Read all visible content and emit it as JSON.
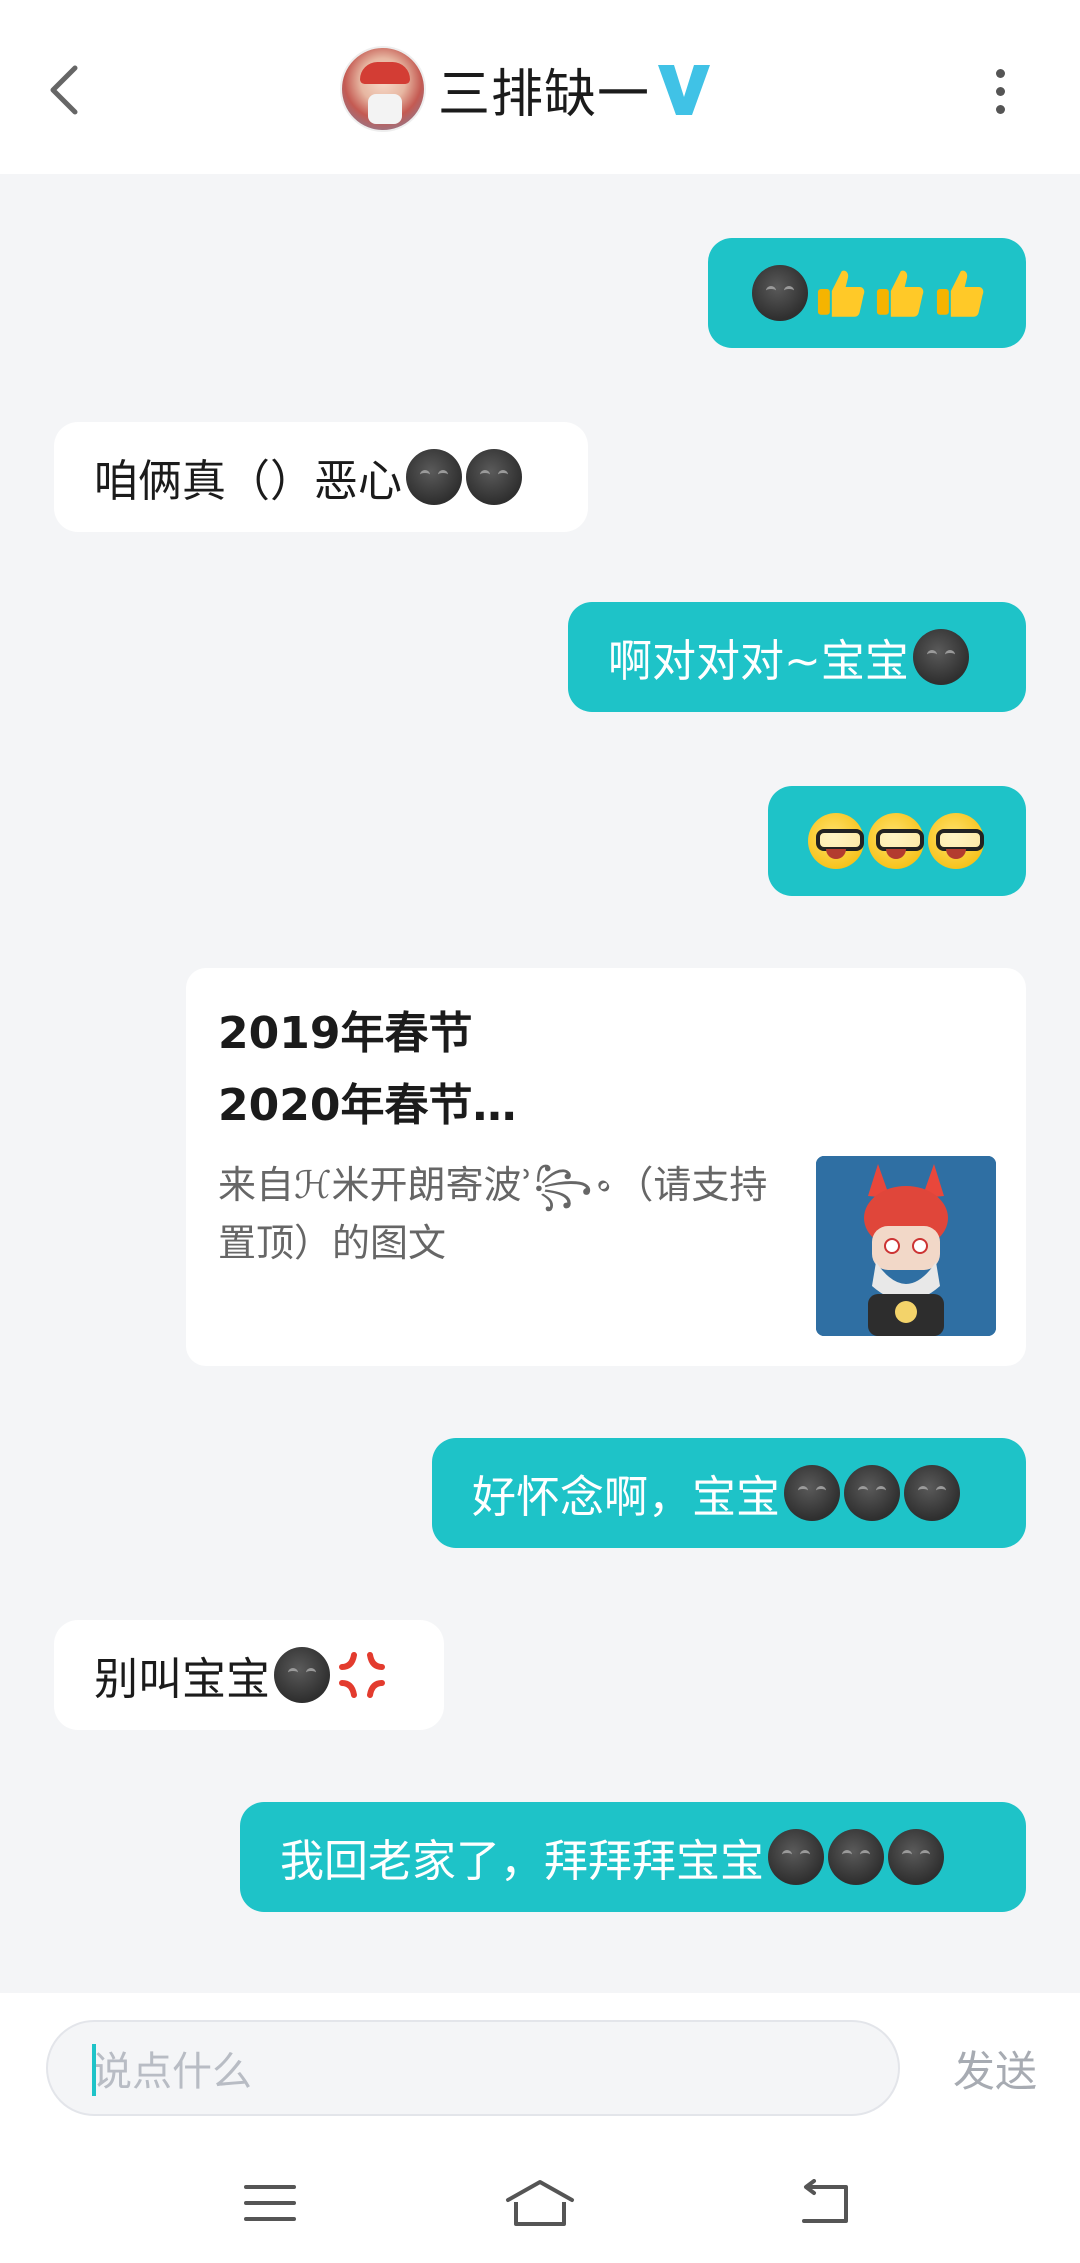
{
  "header": {
    "title": "三排缺一",
    "back_icon": "chevron-left-icon",
    "more_icon": "vertical-dots-icon",
    "badge_icon": "vip-v-icon",
    "badge_color": "#40c2e6"
  },
  "colors": {
    "sent_bubble": "#1ec3c8",
    "received_bubble": "#ffffff",
    "background": "#f4f5f7"
  },
  "messages": [
    {
      "side": "sent",
      "text": "",
      "emoji": [
        "smirk-face",
        "thumbs-up",
        "thumbs-up",
        "thumbs-up"
      ]
    },
    {
      "side": "received",
      "text": "咱俩真（）恶心",
      "emoji": [
        "smirk-face",
        "smirk-face"
      ]
    },
    {
      "side": "sent",
      "text": "啊对对对~宝宝",
      "emoji": [
        "smirk-face"
      ]
    },
    {
      "side": "sent",
      "text": "",
      "emoji": [
        "nerd-face",
        "nerd-face",
        "nerd-face"
      ]
    },
    {
      "side": "sent",
      "type": "shared-post"
    },
    {
      "side": "sent",
      "text": "好怀念啊，宝宝",
      "emoji": [
        "smirk-face",
        "smirk-face",
        "smirk-face"
      ]
    },
    {
      "side": "received",
      "text": "别叫宝宝",
      "emoji": [
        "smirk-face",
        "anger-symbol"
      ]
    },
    {
      "side": "sent",
      "text": "我回老家了，拜拜拜宝宝",
      "emoji": [
        "smirk-face",
        "smirk-face",
        "smirk-face"
      ]
    }
  ],
  "shared_post": {
    "title_line1": "2019年春节",
    "title_line2": "2020年春节…",
    "source_line1": "来自ℋ米开朗寄波ʾ꧂꠶（请支持",
    "source_line2": "置顶）的图文"
  },
  "composer": {
    "placeholder": "说点什么",
    "send_label": "发送"
  },
  "navbar": {
    "icons": [
      "menu-icon",
      "home-icon",
      "back-icon"
    ]
  }
}
